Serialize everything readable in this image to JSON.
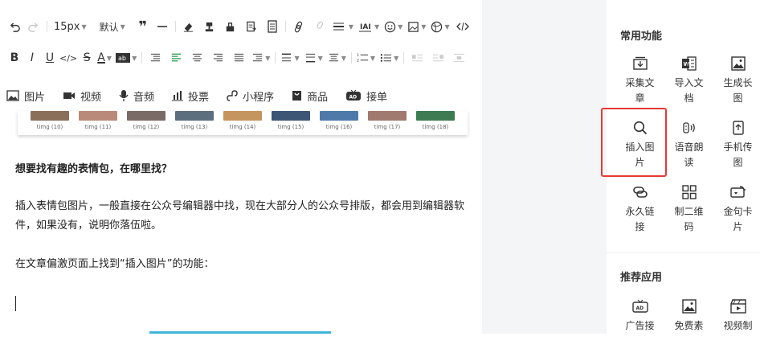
{
  "toolbar": {
    "font_size": "15px",
    "font_family": "默认"
  },
  "insert_bar": [
    {
      "label": "图片",
      "icon": "image-icon"
    },
    {
      "label": "视频",
      "icon": "video-icon"
    },
    {
      "label": "音频",
      "icon": "microphone-icon"
    },
    {
      "label": "投票",
      "icon": "bar-chart-icon"
    },
    {
      "label": "小程序",
      "icon": "mini-program-icon"
    },
    {
      "label": "商品",
      "icon": "shopping-bag-icon"
    },
    {
      "label": "接单",
      "icon": "ad-icon"
    }
  ],
  "thumbnails": [
    {
      "caption": "timg (10)",
      "color": "#8a6f5a"
    },
    {
      "caption": "timg (11)",
      "color": "#b98a7a"
    },
    {
      "caption": "timg (12)",
      "color": "#7b6b66"
    },
    {
      "caption": "timg (13)",
      "color": "#5c6f7e"
    },
    {
      "caption": "timg (14)",
      "color": "#c4955e"
    },
    {
      "caption": "timg (15)",
      "color": "#3d5676"
    },
    {
      "caption": "timg (16)",
      "color": "#4f79a8"
    },
    {
      "caption": "timg (17)",
      "color": "#a07a6e"
    },
    {
      "caption": "timg (18)",
      "color": "#3e7a52"
    }
  ],
  "content": {
    "heading": "想要找有趣的表情包，在哪里找？",
    "para1": "插入表情包图片，一般直接在公众号编辑器中找，现在大部分人的公众号排版，都会用到编辑器软件，如果没有，说明你落伍啦。",
    "para2": "在文章偏激页面上找到“插入图片”的功能："
  },
  "sidebar": {
    "section1_title": "常用功能",
    "section2_title": "推荐应用",
    "functions": [
      {
        "label": "采集文章",
        "icon": "collect-article-icon"
      },
      {
        "label": "导入文档",
        "icon": "import-doc-icon"
      },
      {
        "label": "生成长图",
        "icon": "long-image-icon"
      },
      {
        "label": "插入图片",
        "icon": "search-icon"
      },
      {
        "label": "语音朗读",
        "icon": "voice-read-icon"
      },
      {
        "label": "手机传图",
        "icon": "phone-upload-icon"
      },
      {
        "label": "永久链接",
        "icon": "link-icon"
      },
      {
        "label": "制二维码",
        "icon": "qrcode-icon"
      },
      {
        "label": "金句卡片",
        "icon": "quote-card-icon"
      }
    ],
    "apps": [
      {
        "label": "广告接",
        "icon": "ad-tv-icon"
      },
      {
        "label": "免费素",
        "icon": "free-image-icon"
      },
      {
        "label": "视频制",
        "icon": "video-make-icon"
      }
    ]
  },
  "colors": {
    "highlight": "#e53935",
    "accent_green": "#2e9e4f"
  }
}
